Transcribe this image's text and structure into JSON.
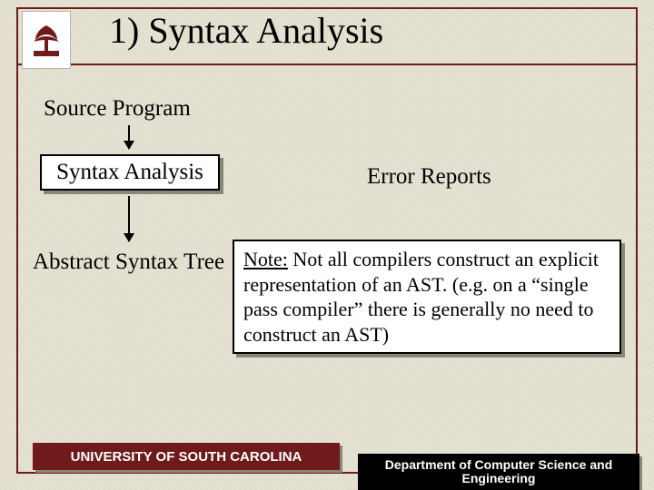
{
  "title": "1) Syntax Analysis",
  "labels": {
    "source": "Source Program",
    "syntax_box": "Syntax Analysis",
    "error": "Error Reports",
    "ast": "Abstract Syntax Tree"
  },
  "note": {
    "lead": "Note:",
    "body": " Not all compilers construct an explicit representation of an AST. (e.g. on a “single pass compiler” there is generally no need to construct an AST)"
  },
  "footer": {
    "left": "UNIVERSITY OF SOUTH CAROLINA",
    "right": "Department of Computer Science and Engineering"
  },
  "colors": {
    "rule": "#6f1b1b",
    "footer_left_bg": "#6f1b1b",
    "footer_right_bg": "#000000"
  }
}
